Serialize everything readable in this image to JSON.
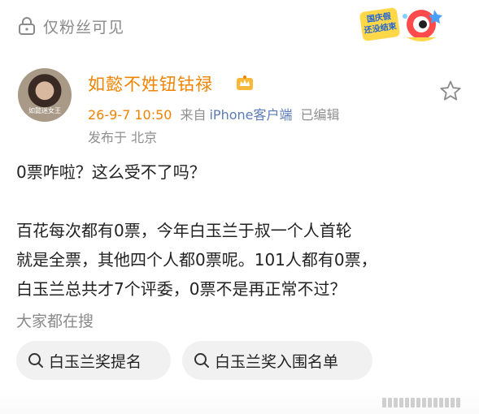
{
  "header": {
    "visibility_label": "仅粉丝可见",
    "promo_badge_text": "国庆假 \n 还没结束",
    "icons": {
      "lock": "lock-icon",
      "mascot": "mascot-illustration"
    }
  },
  "post": {
    "author": {
      "name": "如懿不姓钮钴禄",
      "avatar_caption": "如懿迷女王",
      "badge_icon": "vip-crown-icon"
    },
    "time": "26-9-7 10:50",
    "source_prefix": "来自",
    "device": "iPhone客户端",
    "edited": "已编辑",
    "location": "发布于 北京",
    "favorite_icon": "star-icon",
    "body_lines": [
      "0票咋啦？这么受不了吗？",
      "",
      "百花每次都有0票，今年白玉兰于叔一个人首轮",
      "就是全票，其他四个人都0票呢。101人都有0票，",
      "白玉兰总共才7个评委，0票不是再正常不过？"
    ]
  },
  "trending": {
    "title": "大家都在搜",
    "chips": [
      "白玉兰奖提名",
      "白玉兰奖入围名单"
    ],
    "chip_icon": "search-icon"
  },
  "colors": {
    "accent_orange": "#f08300",
    "link_blue": "#5b7bb6",
    "muted_gray": "#8f8f8f",
    "chip_bg": "#f1f1f1"
  }
}
